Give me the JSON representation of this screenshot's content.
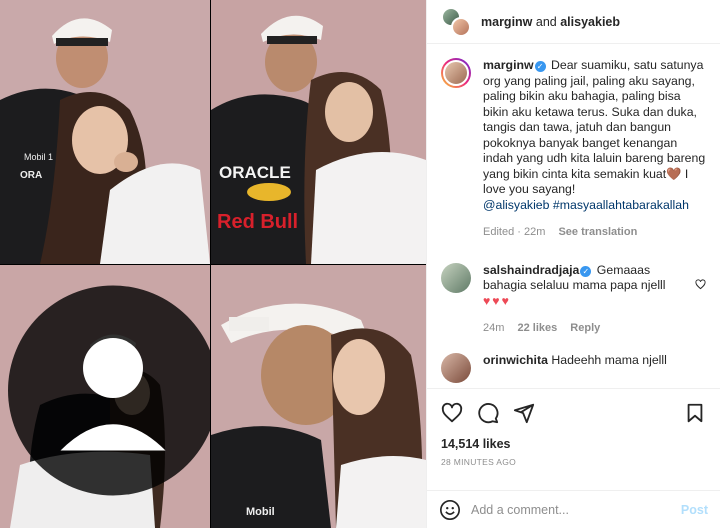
{
  "header": {
    "user1": "marginw",
    "and_text": "and",
    "user2": "alisyakieb"
  },
  "caption": {
    "username": "marginw",
    "text": "Dear suamiku, satu satunya org yang paling jail, paling aku sayang, paling bikin aku bahagia, paling bisa bikin aku ketawa terus. Suka dan duka, tangis dan tawa, jatuh dan bangun pokoknya banyak banget kenangan indah yang udh kita laluin bareng bareng yang bikin cinta kita semakin kuat🤎 I love you sayang!",
    "mention": "@alisyakieb",
    "hashtag": "#masyaallahtabarakallah",
    "edited": "Edited · 22m",
    "see_translation": "See translation"
  },
  "comments": [
    {
      "username": "salshaindradjaja",
      "text": "Gemaaas bahagia selaluu mama papa njelll",
      "hearts": "♥♥♥",
      "time": "24m",
      "likes": "22 likes",
      "reply": "Reply"
    },
    {
      "username": "orinwichita",
      "text": "Hadeehh mama njelll"
    }
  ],
  "likes": "14,514 likes",
  "time_ago": "28 MINUTES AGO",
  "add_comment": {
    "placeholder": "Add a comment...",
    "post_label": "Post"
  },
  "icons": {
    "like": "heart-icon",
    "comment": "comment-icon",
    "share": "share-icon",
    "save": "bookmark-icon",
    "emoji": "emoji-icon"
  },
  "photo": {
    "jersey_text": "ORACLE",
    "jersey_brand": "Red Bull",
    "jersey_small": "Mobil 1"
  }
}
